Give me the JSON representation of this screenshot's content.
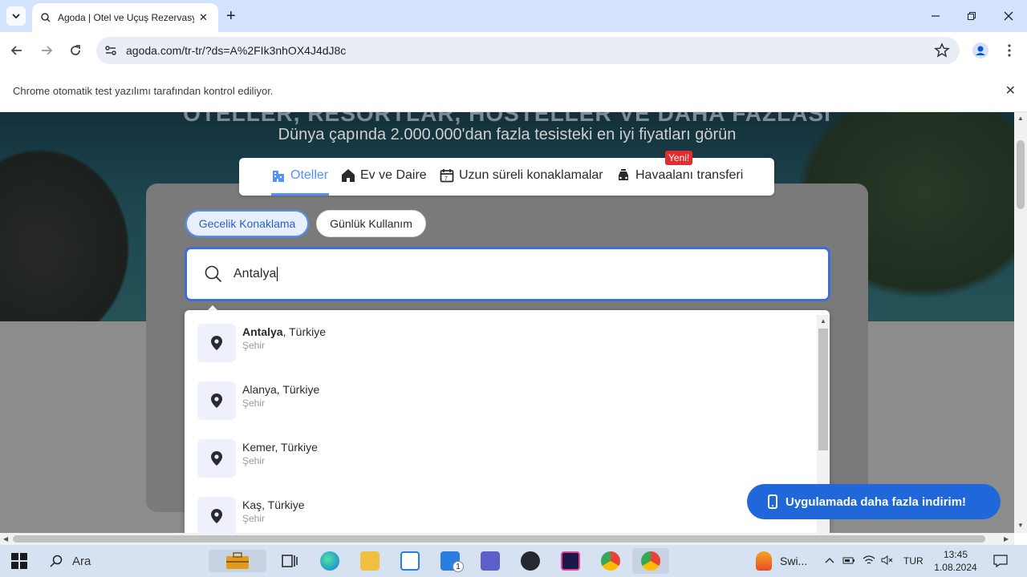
{
  "browser": {
    "tab_title": "Agoda | Otel ve Uçuş Rezervasyonu",
    "url": "agoda.com/tr-tr/?ds=A%2FIk3nhOX4J4dJ8c",
    "infobar_text": "Chrome otomatik test yazılımı tarafından kontrol ediliyor."
  },
  "hero": {
    "headline": "OTELLER, RESORTLAR, HOSTELLER VE DAHA FAZLASI",
    "subtitle": "Dünya çapında 2.000.000'dan fazla tesisteki en iyi fiyatları görün"
  },
  "product_tabs": [
    {
      "label": "Oteller",
      "icon": "hotel-icon",
      "active": true
    },
    {
      "label": "Ev ve Daire",
      "icon": "home-icon"
    },
    {
      "label": "Uzun süreli konaklamalar",
      "icon": "calendar-icon"
    },
    {
      "label": "Havaalanı transferi",
      "icon": "car-icon",
      "badge": "Yeni!"
    }
  ],
  "booking_type": {
    "overnight": "Gecelik Konaklama",
    "day_use": "Günlük Kullanım"
  },
  "search": {
    "value": "Antalya"
  },
  "suggestions": [
    {
      "bold": "Antalya",
      "rest": ", Türkiye",
      "type": "Şehir"
    },
    {
      "bold": "",
      "rest": "Alanya, Türkiye",
      "type": "Şehir"
    },
    {
      "bold": "",
      "rest": "Kemer, Türkiye",
      "type": "Şehir"
    },
    {
      "bold": "",
      "rest": "Kaş, Türkiye",
      "type": "Şehir"
    }
  ],
  "app_banner": "Uygulamada daha fazla indirim!",
  "taskbar": {
    "search_label": "Ara",
    "app_label": "Swi...",
    "language": "TUR",
    "time": "13:45",
    "date": "1.08.2024",
    "notification_count": "1"
  },
  "colors": {
    "accent": "#5392f9",
    "search_border": "#3d6ddb",
    "banner": "#2067da",
    "badge": "#e12d2d"
  }
}
